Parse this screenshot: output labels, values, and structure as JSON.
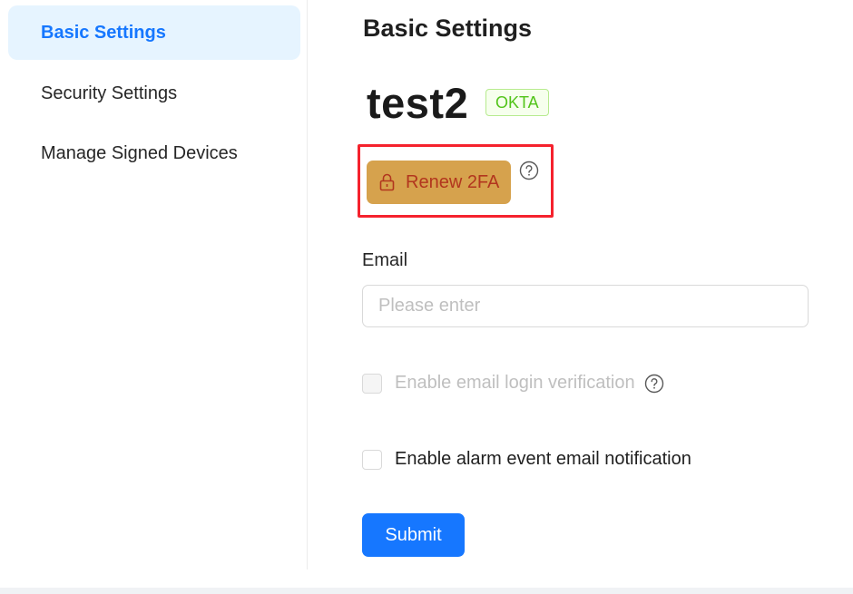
{
  "sidebar": {
    "items": [
      {
        "label": "Basic Settings",
        "active": true
      },
      {
        "label": "Security Settings",
        "active": false
      },
      {
        "label": "Manage Signed Devices",
        "active": false
      }
    ]
  },
  "main": {
    "title": "Basic Settings",
    "username": "test2",
    "provider_tag": "OKTA",
    "renew_button": {
      "label": "Renew 2FA",
      "icon": "lock-icon"
    },
    "email": {
      "label": "Email",
      "placeholder": "Please enter",
      "value": ""
    },
    "options": [
      {
        "label": "Enable email login verification",
        "checked": false,
        "disabled": true
      },
      {
        "label": "Enable alarm event email notification",
        "checked": false,
        "disabled": false
      }
    ],
    "submit_label": "Submit"
  },
  "colors": {
    "accent": "#1677ff",
    "active_bg": "#e6f4ff",
    "renew_bg": "#d6a24d",
    "renew_text": "#b2361e",
    "tag_green": "#52c41a",
    "highlight_red": "#f5222d"
  }
}
